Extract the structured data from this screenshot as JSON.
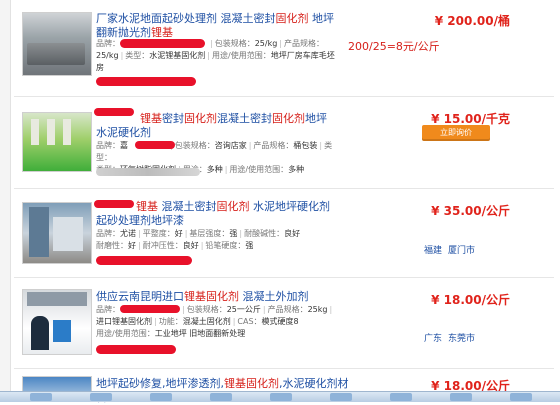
{
  "listings": [
    {
      "title_blue": "厂家水泥地面起砂处理剂 混凝土密封",
      "title_red": "固化剂",
      "title_blue2": " 地坪翻新抛光剂",
      "title_red2": "锂基",
      "brand_label": "品牌：",
      "spec_label": "包装规格：",
      "spec_value": "25/kg",
      "spec2_label": "产品规格：",
      "spec2_value": "25/kg",
      "type_label": "类型：",
      "type_value": "水泥锂基固化剂",
      "use_label": "用途/使用范围：",
      "use_value": "地坪厂房车库毛坯房",
      "price": "¥ 200.00/桶",
      "note": "200/25=8元/公斤"
    },
    {
      "title_red": "锂基",
      "title_blue": "密封",
      "title_red2": "固化剂",
      "title_blue2": "混凝土密封",
      "title_red3": "固化剂",
      "title_blue3": "地坪 水泥硬化剂",
      "brand_label": "品牌：",
      "brand_value": "嘉",
      "spec_label": "包装规格：",
      "spec_value": "咨询店家",
      "spec2_label": "产品规格：",
      "spec2_value": "桶包装",
      "type_label": "类型：",
      "type_value": "环氧树脂固化剂",
      "use_label": "用途：",
      "use_value": "多种",
      "range_label": "用途/使用范围：",
      "range_value": "多种",
      "price": "¥ 15.00/千克",
      "button": "立即询价"
    },
    {
      "title_red": "锂基",
      "title_blue": " 混凝土密封",
      "title_red2": "固化剂",
      "title_blue2": " 水泥地坪硬化剂起砂处理剂地坪漆",
      "brand_label": "品牌：",
      "brand_value": "尤诺",
      "flat_label": "平整度：",
      "flat_value": "好",
      "alk_label": "基层强度：",
      "alk_value": "强",
      "alkres_label": "耐酸碱性：",
      "alkres_value": "良好",
      "wear_label": "耐磨性：",
      "wear_value": "好",
      "press_label": "耐冲压性：",
      "press_value": "良好",
      "pencil_label": "铅笔硬度：",
      "pencil_value": "强",
      "price": "¥ 35.00/公斤",
      "loc1": "福建",
      "loc2": "厦门市"
    },
    {
      "title_blue": "供应云南昆明进口",
      "title_red": "锂基固化剂",
      "title_blue2": " 混凝土外加剂",
      "brand_label": "品牌：",
      "spec_label": "包装规格：",
      "spec_value": "25一公斤",
      "spec2_label": "产品规格：",
      "spec2_value": "25kg",
      "type_label": "类型：",
      "type_value": "进口锂基固化剂",
      "cat_label": "功能：",
      "cat_value": "混凝土固化剂",
      "cas_label": "CAS：",
      "cas_value": "模式硬度8",
      "use_label": "用途/使用范围：",
      "use_value": "工业地坪 旧地面翻新处理",
      "price": "¥ 18.00/公斤",
      "loc1": "广东",
      "loc2": "东莞市"
    },
    {
      "title_blue": "地坪起砂修复,地坪渗透剂,",
      "title_red": "锂基固化剂",
      "title_blue2": ",水泥硬化剂材料",
      "price": "¥ 18.00/公斤"
    }
  ]
}
